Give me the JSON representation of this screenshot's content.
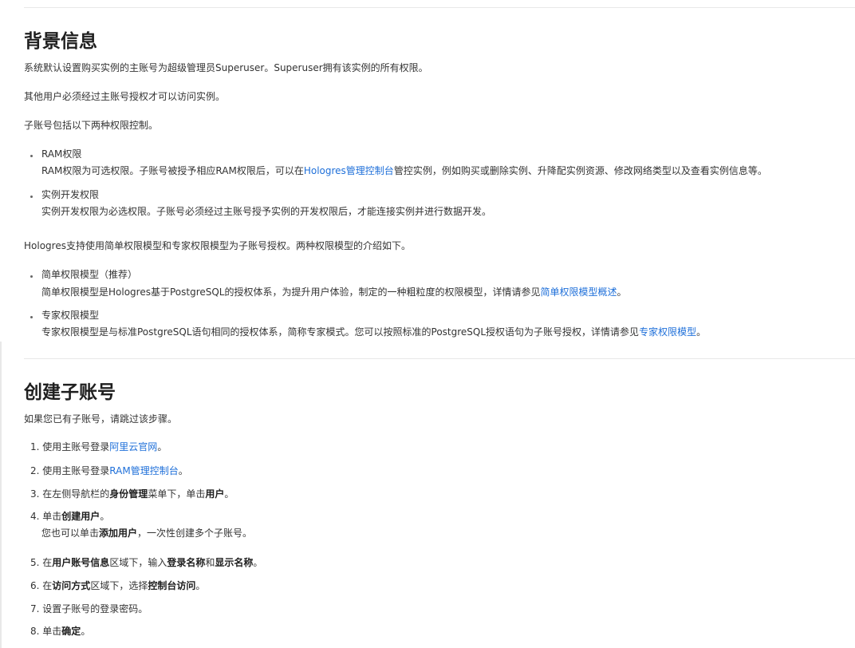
{
  "section1": {
    "title": "背景信息",
    "p1": "系统默认设置购买实例的主账号为超级管理员Superuser。Superuser拥有该实例的所有权限。",
    "p2": "其他用户必须经过主账号授权才可以访问实例。",
    "p3": "子账号包括以下两种权限控制。",
    "ram": {
      "title": "RAM权限",
      "desc_before": "RAM权限为可选权限。子账号被授予相应RAM权限后，可以在",
      "link": "Hologres管理控制台",
      "desc_after": "管控实例，例如购买或删除实例、升降配实例资源、修改网络类型以及查看实例信息等。"
    },
    "dev": {
      "title": "实例开发权限",
      "desc": "实例开发权限为必选权限。子账号必须经过主账号授予实例的开发权限后，才能连接实例并进行数据开发。"
    },
    "p4": "Hologres支持使用简单权限模型和专家权限模型为子账号授权。两种权限模型的介绍如下。",
    "simple": {
      "title": "简单权限模型（推荐）",
      "desc_before": "简单权限模型是Hologres基于PostgreSQL的授权体系，为提升用户体验，制定的一种粗粒度的权限模型，详情请参见",
      "link": "简单权限模型概述",
      "desc_after": "。"
    },
    "expert": {
      "title": "专家权限模型",
      "desc_before": "专家权限模型是与标准PostgreSQL语句相同的授权体系，简称专家模式。您可以按照标准的PostgreSQL授权语句为子账号授权，详情请参见",
      "link": "专家权限模型",
      "desc_after": "。"
    }
  },
  "section2": {
    "title": "创建子账号",
    "intro": "如果您已有子账号，请跳过该步骤。",
    "s1": {
      "num": "1.",
      "a": "使用主账号登录",
      "link": "阿里云官网",
      "b": "。"
    },
    "s2": {
      "num": "2.",
      "a": "使用主账号登录",
      "link": "RAM管理控制台",
      "b": "。"
    },
    "s3": {
      "num": "3.",
      "a": "在左侧导航栏的",
      "bold1": "身份管理",
      "b": "菜单下，单击",
      "bold2": "用户",
      "c": "。"
    },
    "s4": {
      "num": "4.",
      "a": "单击",
      "bold1": "创建用户",
      "b": "。",
      "sub_a": "您也可以单击",
      "sub_bold": "添加用户",
      "sub_b": "，一次性创建多个子账号。"
    },
    "s5": {
      "num": "5.",
      "a": "在",
      "bold1": "用户账号信息",
      "b": "区域下，输入",
      "bold2": "登录名称",
      "c": "和",
      "bold3": "显示名称",
      "d": "。"
    },
    "s6": {
      "num": "6.",
      "a": "在",
      "bold1": "访问方式",
      "b": "区域下，选择",
      "bold2": "控制台访问",
      "c": "。"
    },
    "s7": {
      "num": "7.",
      "a": "设置子账号的登录密码。"
    },
    "s8": {
      "num": "8.",
      "a": "单击",
      "bold1": "确定",
      "b": "。"
    }
  },
  "colors": {
    "link": "#1e6fd9",
    "text": "#333333",
    "heading": "#1f1f1f"
  }
}
